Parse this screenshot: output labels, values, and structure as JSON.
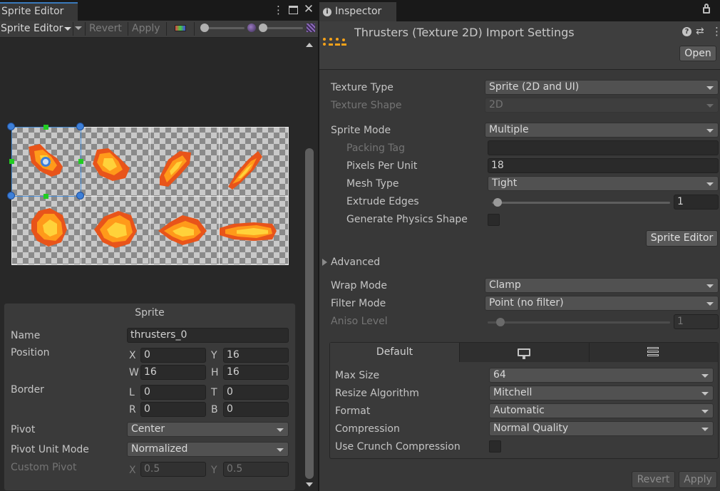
{
  "sprite_editor": {
    "tab_title": "Sprite Editor",
    "toolbar": {
      "mode_label": "Sprite Editor",
      "revert_label": "Revert",
      "apply_label": "Apply"
    },
    "panel": {
      "title": "Sprite",
      "name_label": "Name",
      "name_value": "thrusters_0",
      "position_label": "Position",
      "x_label": "X",
      "x_value": "0",
      "y_label": "Y",
      "y_value": "16",
      "w_label": "W",
      "w_value": "16",
      "h_label": "H",
      "h_value": "16",
      "border_label": "Border",
      "l_label": "L",
      "l_value": "0",
      "t_label": "T",
      "t_value": "0",
      "r_label": "R",
      "r_value": "0",
      "b_label": "B",
      "b_value": "0",
      "pivot_label": "Pivot",
      "pivot_value": "Center",
      "pivot_unit_label": "Pivot Unit Mode",
      "pivot_unit_value": "Normalized",
      "custom_pivot_label": "Custom Pivot",
      "cp_x_label": "X",
      "cp_x_value": "0.5",
      "cp_y_label": "Y",
      "cp_y_value": "0.5"
    }
  },
  "inspector": {
    "tab_title": "Inspector",
    "header_title": "Thrusters (Texture 2D) Import Settings",
    "open_label": "Open",
    "rows": {
      "texture_type_label": "Texture Type",
      "texture_type_value": "Sprite (2D and UI)",
      "texture_shape_label": "Texture Shape",
      "texture_shape_value": "2D",
      "sprite_mode_label": "Sprite Mode",
      "sprite_mode_value": "Multiple",
      "packing_tag_label": "Packing Tag",
      "packing_tag_value": "",
      "ppu_label": "Pixels Per Unit",
      "ppu_value": "18",
      "mesh_type_label": "Mesh Type",
      "mesh_type_value": "Tight",
      "extrude_label": "Extrude Edges",
      "extrude_value": "1",
      "physics_label": "Generate Physics Shape",
      "sprite_editor_button": "Sprite Editor",
      "advanced_label": "Advanced",
      "wrap_label": "Wrap Mode",
      "wrap_value": "Clamp",
      "filter_label": "Filter Mode",
      "filter_value": "Point (no filter)",
      "aniso_label": "Aniso Level",
      "aniso_value": "1"
    },
    "platform": {
      "default_tab": "Default",
      "max_size_label": "Max Size",
      "max_size_value": "64",
      "resize_label": "Resize Algorithm",
      "resize_value": "Mitchell",
      "format_label": "Format",
      "format_value": "Automatic",
      "compression_label": "Compression",
      "compression_value": "Normal Quality",
      "crunch_label": "Use Crunch Compression"
    },
    "footer": {
      "revert_label": "Revert",
      "apply_label": "Apply"
    }
  }
}
